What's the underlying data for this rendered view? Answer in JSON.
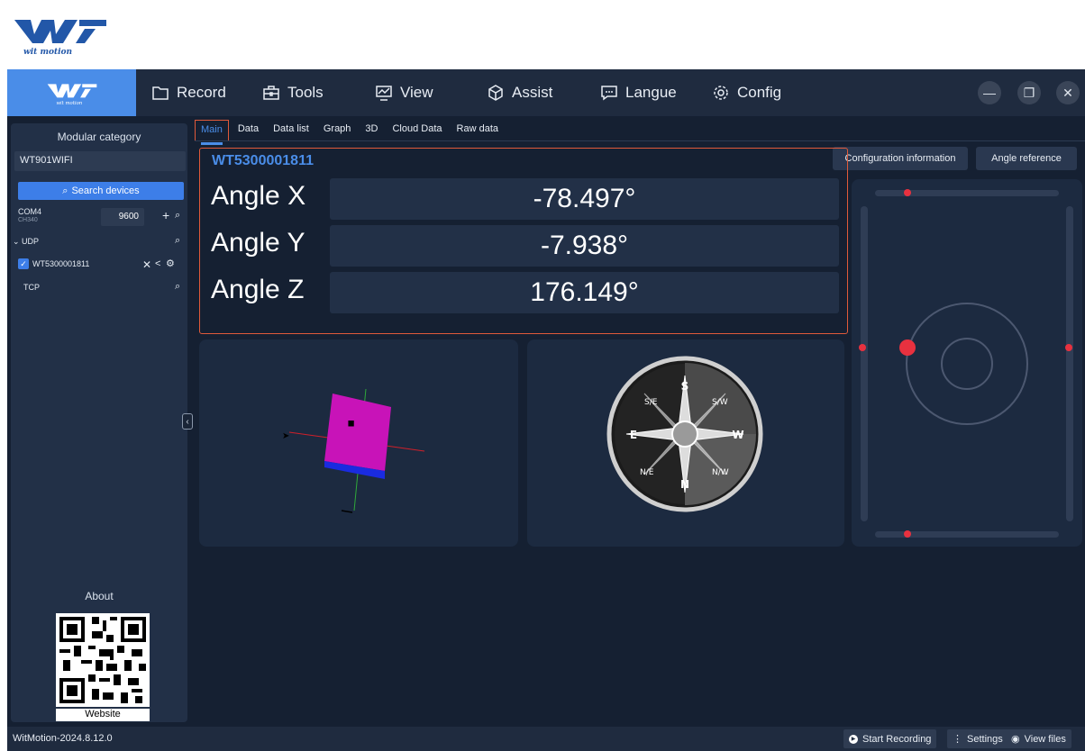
{
  "brand_text": "wit motion",
  "menu": [
    {
      "label": "Record",
      "icon": "folder-icon"
    },
    {
      "label": "Tools",
      "icon": "toolbox-icon"
    },
    {
      "label": "View",
      "icon": "monitor-chart-icon"
    },
    {
      "label": "Assist",
      "icon": "cube-icon"
    },
    {
      "label": "Langue",
      "icon": "chat-icon"
    },
    {
      "label": "Config",
      "icon": "gear-icon"
    }
  ],
  "sidebar": {
    "title": "Modular category",
    "module_value": "WT901WIFI",
    "search_label": "Search devices",
    "com_port": "COM4",
    "com_sub": "CH340",
    "baud": "9600",
    "udp_label": "UDP",
    "device": "WT5300001811",
    "tcp_label": "TCP",
    "about_label": "About",
    "website_label": "Website"
  },
  "tabs": [
    "Main",
    "Data",
    "Data list",
    "Graph",
    "3D",
    "Cloud Data",
    "Raw data"
  ],
  "header_buttons": {
    "config_info": "Configuration information",
    "angle_ref": "Angle reference"
  },
  "angles": {
    "device": "WT5300001811",
    "rows": [
      {
        "label": "Angle X",
        "value": "-78.497°"
      },
      {
        "label": "Angle Y",
        "value": "-7.938°"
      },
      {
        "label": "Angle Z",
        "value": "176.149°"
      }
    ]
  },
  "compass_letters": {
    "n": "N",
    "s": "S",
    "e": "E",
    "w": "W",
    "ne": "N/E",
    "nw": "N/W",
    "se": "S/E",
    "sw": "S/W"
  },
  "status": {
    "version": "WitMotion-2024.8.12.0",
    "start_recording": "Start Recording",
    "settings": "Settings",
    "view_files": "View files"
  },
  "colors": {
    "accent": "#4a8de8",
    "highlight": "#e05a3a",
    "dot": "#e8313f",
    "cube_face": "#c813b8"
  }
}
